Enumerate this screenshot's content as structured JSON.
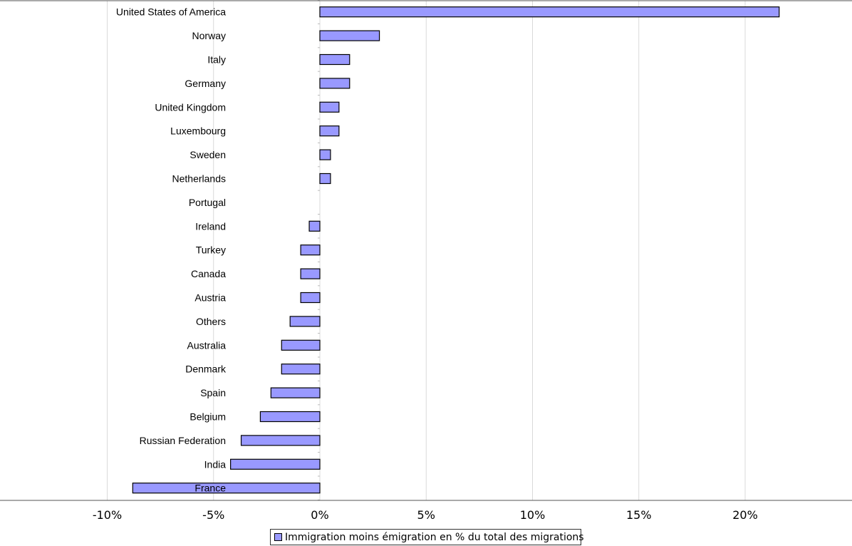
{
  "colors": {
    "bar_fill": "#9999ff",
    "bar_stroke": "#000000",
    "grid": "#d9d9d9"
  },
  "chart_data": {
    "type": "bar",
    "orientation": "horizontal",
    "categories": [
      "United States of America",
      "Norway",
      "Italy",
      "Germany",
      "United Kingdom",
      "Luxembourg",
      "Sweden",
      "Netherlands",
      "Portugal",
      "Ireland",
      "Turkey",
      "Canada",
      "Austria",
      "Others",
      "Australia",
      "Denmark",
      "Spain",
      "Belgium",
      "Russian Federation",
      "India",
      "France"
    ],
    "series": [
      {
        "name": "Immigration moins émigration en % du total des migrations",
        "values": [
          21.6,
          2.8,
          1.4,
          1.4,
          0.9,
          0.9,
          0.5,
          0.5,
          0.0,
          -0.5,
          -0.9,
          -0.9,
          -0.9,
          -1.4,
          -1.8,
          -1.8,
          -2.3,
          -2.8,
          -3.7,
          -4.2,
          -8.8
        ]
      }
    ],
    "xlim": [
      -10,
      25
    ],
    "xticks": [
      -10,
      -5,
      0,
      5,
      10,
      15,
      20
    ],
    "xtick_labels": [
      "-10%",
      "-5%",
      "0%",
      "5%",
      "10%",
      "15%",
      "20%"
    ],
    "grid": true,
    "legend_position": "bottom-center"
  }
}
